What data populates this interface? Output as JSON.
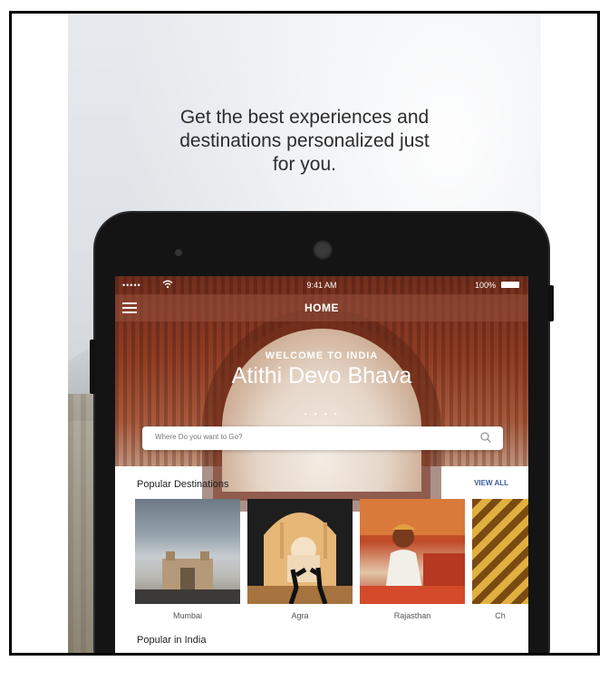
{
  "headline": [
    "Get the best experiences and",
    "destinations personalized just",
    "for you."
  ],
  "status_bar": {
    "signal": "•••••",
    "time": "9:41 AM",
    "battery": "100%"
  },
  "navbar": {
    "title": "HOME"
  },
  "hero": {
    "welcome": "WELCOME TO INDIA",
    "tagline": "Atithi Devo Bhava",
    "dots": "• • • •"
  },
  "search": {
    "placeholder": "Where Do you want to Go?"
  },
  "popular_destinations": {
    "title": "Popular Destinations",
    "view_all": "VIEW ALL",
    "items": [
      {
        "label": "Mumbai"
      },
      {
        "label": "Agra"
      },
      {
        "label": "Rajasthan"
      },
      {
        "label": "Ch"
      }
    ]
  },
  "popular_in_india": {
    "title": "Popular in India"
  },
  "colors": {
    "accent": "#3d5a9c",
    "phone_body": "#141414",
    "hero_red": "#8c3a22"
  },
  "icons": {
    "menu": "hamburger-menu-icon",
    "wifi": "wifi-icon",
    "battery": "battery-icon",
    "search": "search-icon"
  }
}
